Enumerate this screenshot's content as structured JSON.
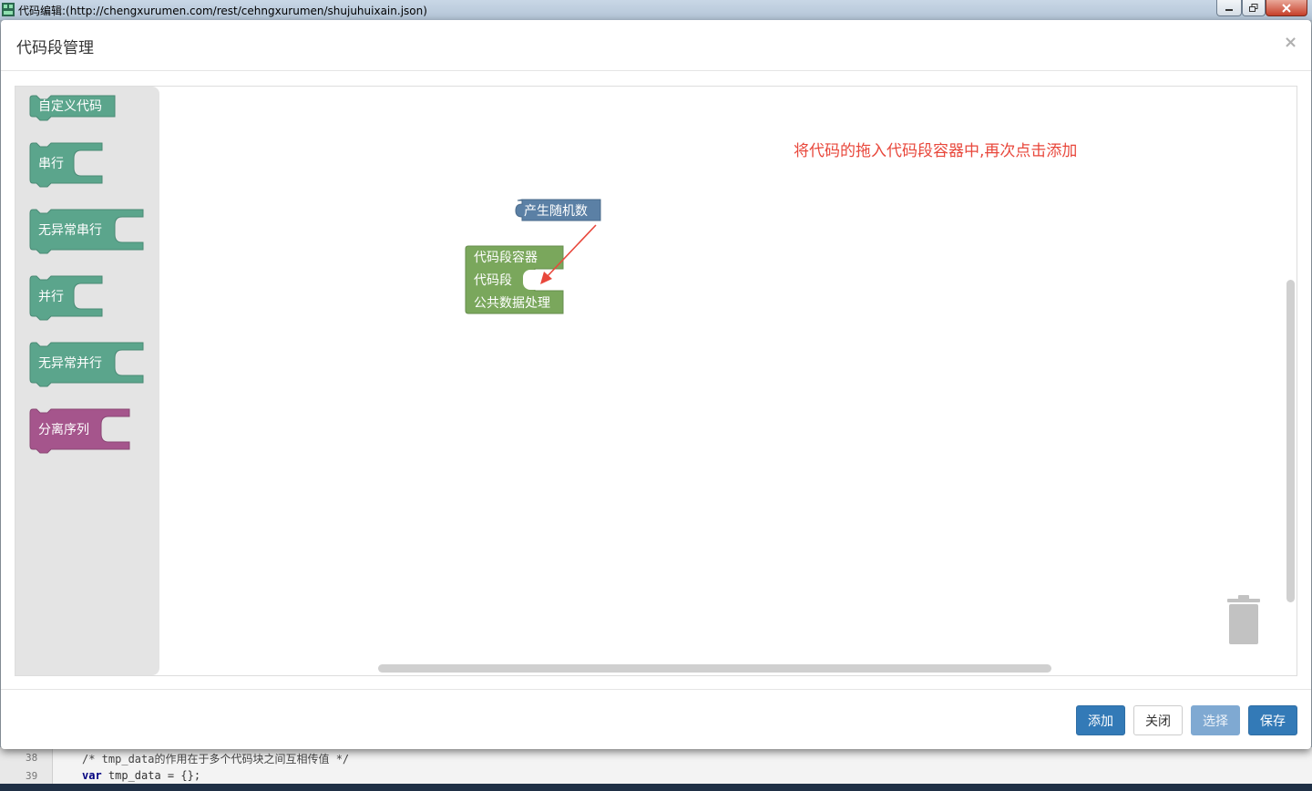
{
  "window": {
    "title": "代码编辑:(http://chengxurumen.com/rest/cehngxurumen/shujuhuixain.json)"
  },
  "modal": {
    "title": "代码段管理",
    "close_symbol": "×",
    "hint": "将代码的拖入代码段容器中,再次点击添加"
  },
  "toolbox": {
    "items": [
      {
        "label": "自定义代码",
        "color": "#5ba58c"
      },
      {
        "label": "串行",
        "color": "#5ba58c"
      },
      {
        "label": "无异常串行",
        "color": "#5ba58c"
      },
      {
        "label": "并行",
        "color": "#5ba58c"
      },
      {
        "label": "无异常并行",
        "color": "#5ba58c"
      },
      {
        "label": "分离序列",
        "color": "#a5558c"
      }
    ]
  },
  "canvas_blocks": {
    "random_block": {
      "label": "产生随机数",
      "color": "#5b80a5"
    },
    "container_block": {
      "title": "代码段容器",
      "slot_label": "代码段",
      "bottom_label": "公共数据处理",
      "color": "#7aa75c"
    }
  },
  "footer": {
    "add": "添加",
    "close": "关闭",
    "select": "选择",
    "save": "保存"
  },
  "editor": {
    "line_numbers": [
      "38",
      "39"
    ],
    "lines": [
      {
        "comment": "/* tmp_data的作用在于多个代码块之间互相传值 */"
      },
      {
        "keyword": "var",
        "rest": " tmp_data = {};"
      }
    ]
  }
}
